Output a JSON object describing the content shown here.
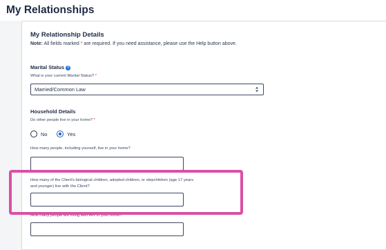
{
  "page": {
    "title": "My Relationships"
  },
  "details": {
    "heading": "My Relationship Details",
    "note_label": "Note:",
    "note_before": " All fields marked ",
    "note_star": "*",
    "note_after": " are required. If you need assistance, please use the Help button above."
  },
  "marital": {
    "heading": "Marital Status",
    "info_icon": "i",
    "question": "What is your current Marital Status?",
    "required_mark": "*",
    "selected_value": "Married/Common Law"
  },
  "household": {
    "heading": "Household Details",
    "question": "Do other people live in your home?",
    "required_mark": "*",
    "options": [
      {
        "label": "No",
        "selected": false
      },
      {
        "label": "Yes",
        "selected": true
      }
    ],
    "q_people": "How many people, including yourself, live in your home?",
    "q_people_value": "",
    "q_children": "How many of the Client's biological children, adopted children, or stepchildren (age 17 years and younger) live with the Client?",
    "q_children_value": "",
    "q_hiv": "How many people are living with HIV in your home?",
    "q_hiv_value": ""
  },
  "colors": {
    "highlight": "#d94fa6",
    "required": "#d8262f",
    "radio_selected": "#1a5fc2",
    "info_icon": "#1a73d9"
  }
}
